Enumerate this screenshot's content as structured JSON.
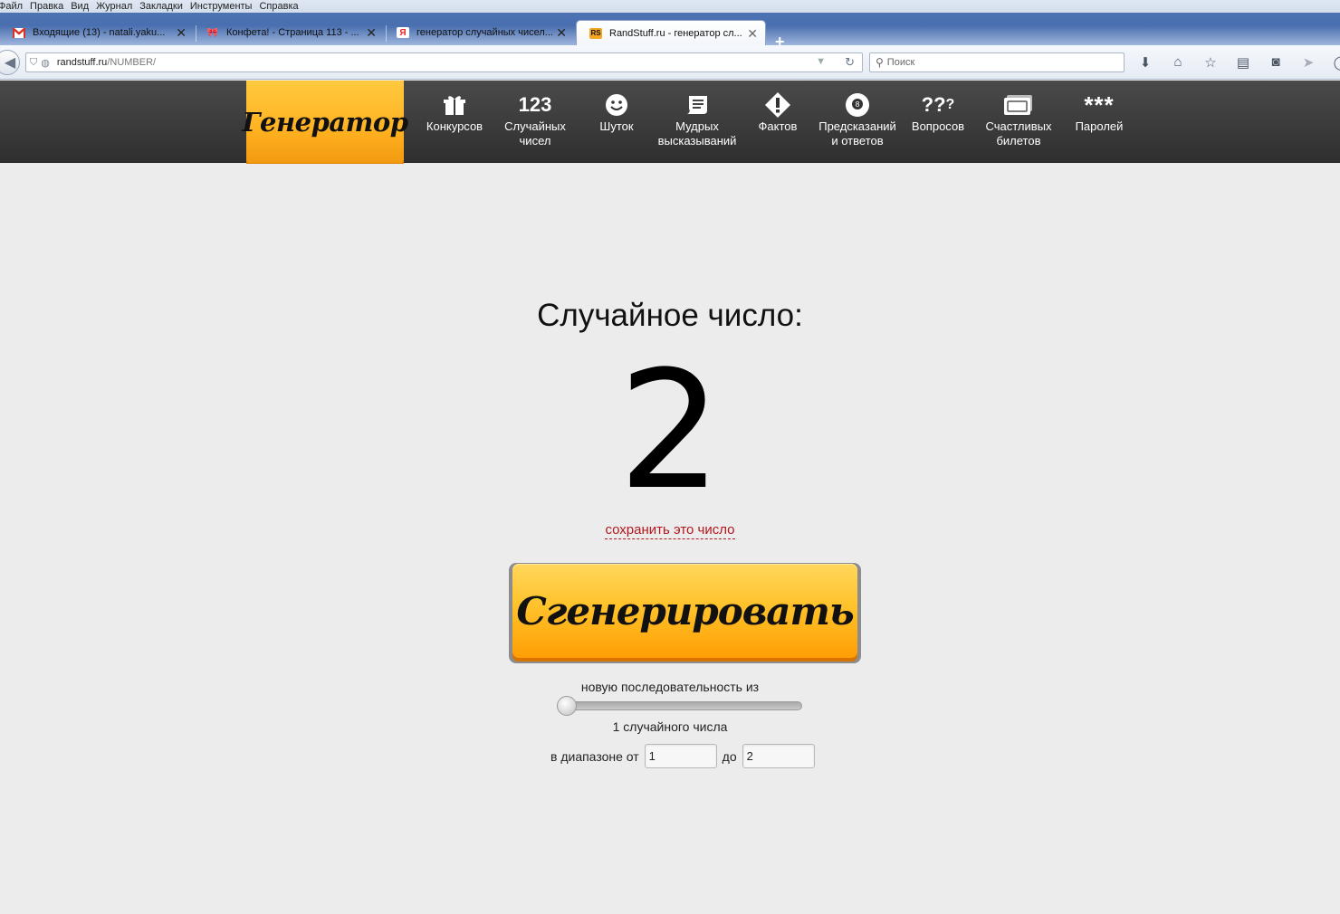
{
  "menu": [
    {
      "label": "Файл"
    },
    {
      "label": "Правка"
    },
    {
      "label": "Вид"
    },
    {
      "label": "Журнал"
    },
    {
      "label": "Закладки"
    },
    {
      "label": "Инструменты"
    },
    {
      "label": "Справка"
    }
  ],
  "tabs": [
    {
      "title": "Входящие (13) - natali.yaku...",
      "icon": "gmail-icon",
      "active": false
    },
    {
      "title": "Конфета! - Страница 113 - ...",
      "icon": "ribbon-icon",
      "active": false
    },
    {
      "title": "генератор случайных чисел...",
      "icon": "yandex-icon",
      "active": false
    },
    {
      "title": "RandStuff.ru - генератор сл...",
      "icon": "randstuff-icon",
      "active": true
    }
  ],
  "address": {
    "host": "randstuff.ru",
    "path": "/NUMBER/"
  },
  "search": {
    "placeholder": "Поиск"
  },
  "site": {
    "logo": "Генератор",
    "accent": "#ffb221",
    "nav": [
      {
        "label": "Конкурсов",
        "icon": "gift-icon"
      },
      {
        "label": "Случайных чисел",
        "icon": "numbers-123-icon"
      },
      {
        "label": "Шуток",
        "icon": "smiley-icon"
      },
      {
        "label": "Мудрых высказываний",
        "icon": "scroll-icon"
      },
      {
        "label": "Фактов",
        "icon": "exclamation-diamond-icon"
      },
      {
        "label": "Предсказаний и ответов",
        "icon": "magic-8-ball-icon"
      },
      {
        "label": "Вопросов",
        "icon": "question-marks-icon"
      },
      {
        "label": "Счастливых билетов",
        "icon": "ticket-icon"
      },
      {
        "label": "Паролей",
        "icon": "asterisks-icon"
      }
    ]
  },
  "result": {
    "title": "Случайное число:",
    "value": "2",
    "save_link": "сохранить это число",
    "save_color": "#b3171d"
  },
  "generate": {
    "label": "Сгенерировать"
  },
  "sequence": {
    "label": "новую последовательность из",
    "count_label": "1 случайного числа",
    "slider_fraction": 0
  },
  "range": {
    "from_label": "в диапазоне от",
    "from_value": "1",
    "to_label": "до",
    "to_value": "2"
  }
}
